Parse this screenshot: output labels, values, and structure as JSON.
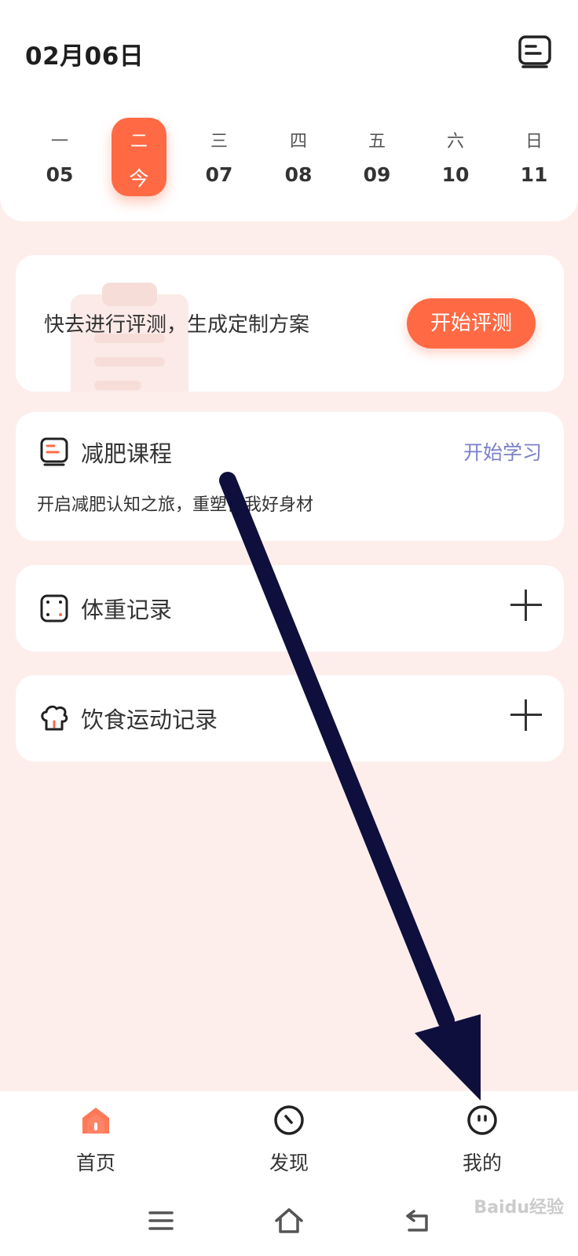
{
  "header": {
    "date_title": "02月06日"
  },
  "week": [
    {
      "weekday": "一",
      "label": "05",
      "selected": false
    },
    {
      "weekday": "二",
      "label": "今",
      "selected": true
    },
    {
      "weekday": "三",
      "label": "07",
      "selected": false
    },
    {
      "weekday": "四",
      "label": "08",
      "selected": false
    },
    {
      "weekday": "五",
      "label": "09",
      "selected": false
    },
    {
      "weekday": "六",
      "label": "10",
      "selected": false
    },
    {
      "weekday": "日",
      "label": "11",
      "selected": false
    }
  ],
  "evaluation": {
    "text": "快去进行评测，生成定制方案",
    "button_label": "开始评测"
  },
  "course": {
    "title": "减肥课程",
    "action_label": "开始学习",
    "description": "开启减肥认知之旅，重塑自我好身材"
  },
  "weight_record": {
    "title": "体重记录"
  },
  "food_record": {
    "title": "饮食运动记录"
  },
  "tabbar": {
    "home_label": "首页",
    "discover_label": "发现",
    "mine_label": "我的"
  },
  "watermark": "Baidu经验",
  "colors": {
    "accent": "#ff6a45",
    "page_background": "#fdeeec",
    "link": "#7b80c8",
    "arrow": "#0f0f3d"
  },
  "icons": {
    "header": "notebook-icon",
    "course": "book-icon",
    "weight": "scale-icon",
    "food": "chef-hat-icon",
    "tab_home": "house-icon",
    "tab_discover": "compass-icon",
    "tab_mine": "face-icon"
  }
}
